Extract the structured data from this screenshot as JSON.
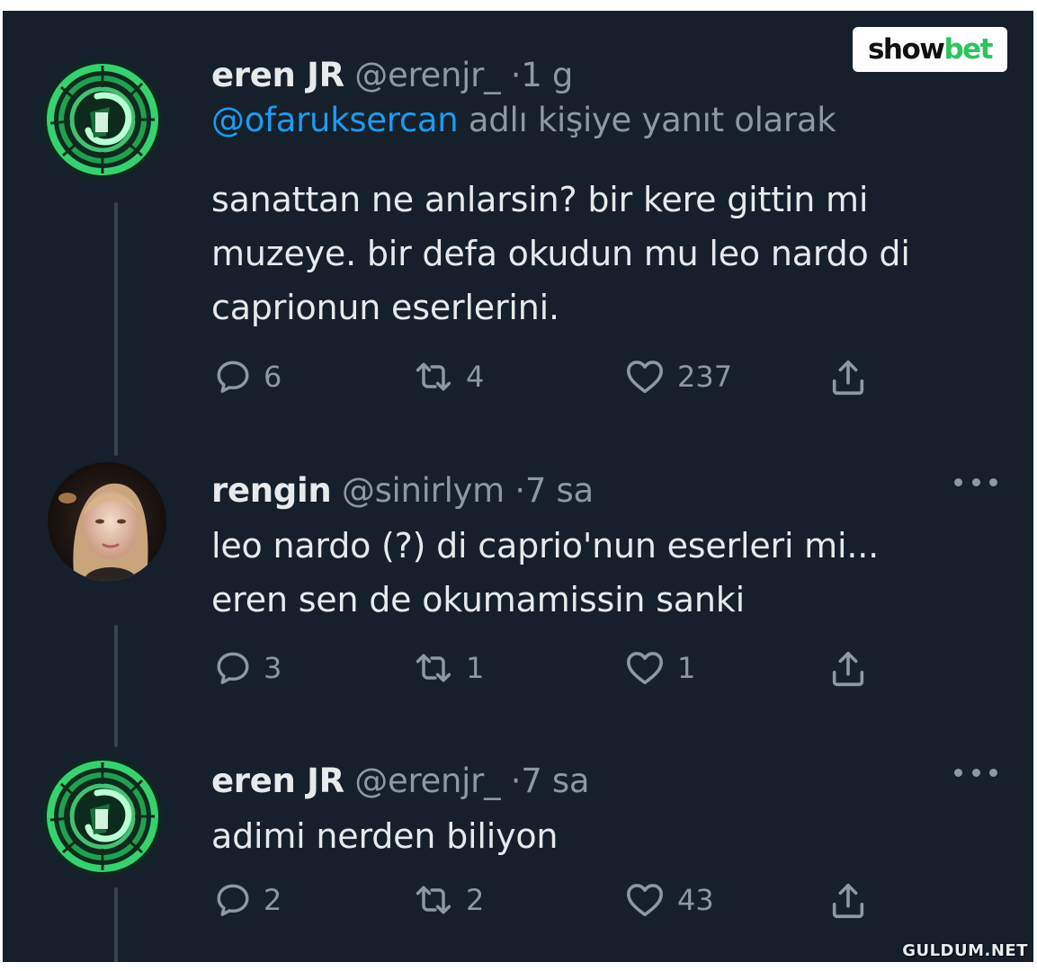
{
  "brand_logo": {
    "part1": "show",
    "part2": "bet",
    "part2_color": "#2cc55e"
  },
  "watermark": "GULDUM.NET",
  "colors": {
    "background": "#15202b",
    "text": "#e7e9ea",
    "secondary": "#8b98a5",
    "mention": "#1d9bf0",
    "thread_line": "#38444d"
  },
  "tweets": [
    {
      "name": "eren JR",
      "handle": "@erenjr_",
      "dot": "·",
      "time": "1 g",
      "reply_mention": "@ofaruksercan",
      "reply_suffix": "adlı kişiye yanıt olarak",
      "text": "sanattan ne anlarsin? bir kere gittin mi\nmuzeye. bir defa okudun mu leo nardo di\ncaprionun eserlerini.",
      "replies": "6",
      "retweets": "4",
      "likes": "237",
      "avatar_icon": "green-spiral-staircase-avatar"
    },
    {
      "name": "rengin",
      "handle": "@sinirlym",
      "dot": "·",
      "time": "7 sa",
      "text": "leo nardo (?) di caprio'nun eserleri mi...\neren sen de okumamissin sanki",
      "replies": "3",
      "retweets": "1",
      "likes": "1",
      "avatar_icon": "woman-portrait-avatar"
    },
    {
      "name": "eren JR",
      "handle": "@erenjr_",
      "dot": "·",
      "time": "7 sa",
      "text": "adimi nerden biliyon",
      "replies": "2",
      "retweets": "2",
      "likes": "43",
      "avatar_icon": "green-spiral-staircase-avatar"
    }
  ]
}
